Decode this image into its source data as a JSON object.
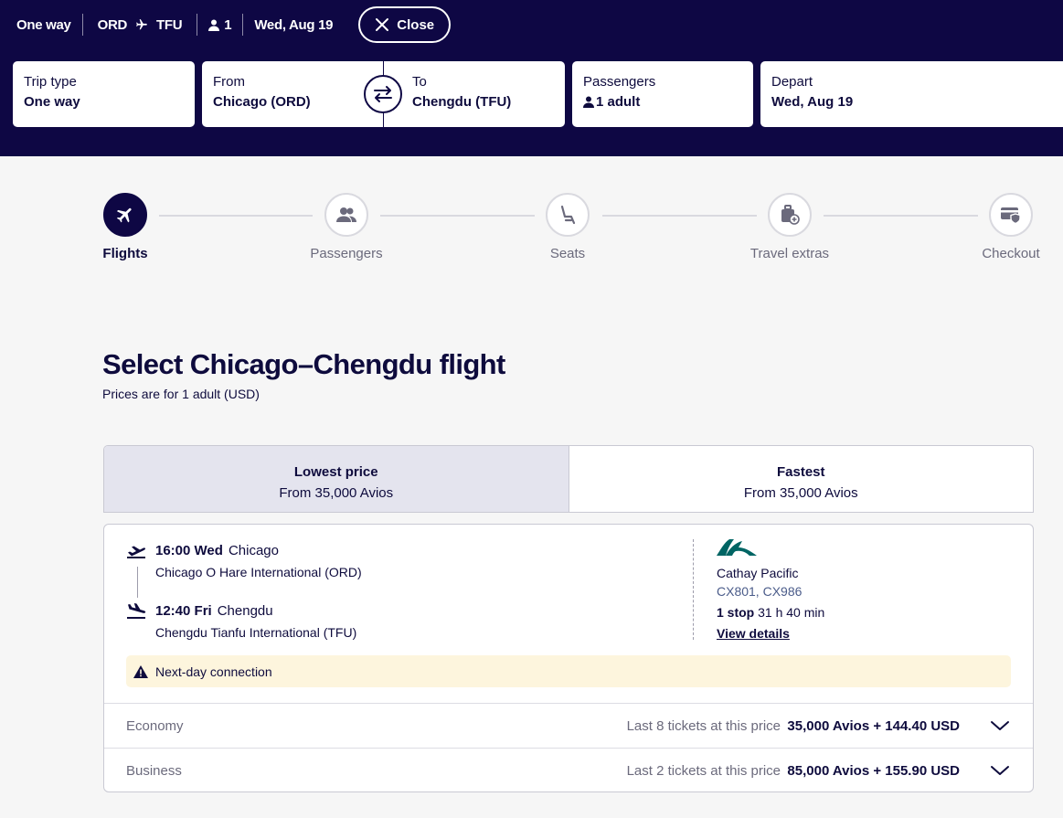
{
  "summary": {
    "trip_type": "One way",
    "origin": "ORD",
    "destination": "TFU",
    "passenger_count": "1",
    "date": "Wed, Aug 19",
    "close_label": "Close"
  },
  "search": {
    "trip_type": {
      "label": "Trip type",
      "value": "One way"
    },
    "from": {
      "label": "From",
      "value": "Chicago (ORD)"
    },
    "to": {
      "label": "To",
      "value": "Chengdu (TFU)"
    },
    "passengers": {
      "label": "Passengers",
      "value": "1 adult"
    },
    "depart": {
      "label": "Depart",
      "value": "Wed, Aug 19"
    }
  },
  "steps": [
    {
      "label": "Flights",
      "icon": "plane-icon",
      "active": true
    },
    {
      "label": "Passengers",
      "icon": "people-icon"
    },
    {
      "label": "Seats",
      "icon": "seat-icon"
    },
    {
      "label": "Travel extras",
      "icon": "luggage-icon"
    },
    {
      "label": "Checkout",
      "icon": "card-shield-icon"
    }
  ],
  "page": {
    "title": "Select Chicago–Chengdu flight",
    "subtitle": "Prices are for 1 adult (USD)"
  },
  "tabs": [
    {
      "name": "Lowest price",
      "price": "From 35,000 Avios",
      "selected": true
    },
    {
      "name": "Fastest",
      "price": "From 35,000 Avios"
    }
  ],
  "flight": {
    "departure": {
      "time": "16:00 Wed",
      "city": "Chicago",
      "airport": "Chicago O Hare International (ORD)"
    },
    "arrival": {
      "time": "12:40 Fri",
      "city": "Chengdu",
      "airport": "Chengdu Tianfu International (TFU)"
    },
    "airline": "Cathay Pacific",
    "flight_numbers": "CX801, CX986",
    "stops": "1 stop",
    "duration": "31 h 40 min",
    "details_link": "View details",
    "warning": "Next-day connection",
    "fares": [
      {
        "cabin": "Economy",
        "availability": "Last 8 tickets at this price",
        "price": "35,000 Avios + 144.40 USD"
      },
      {
        "cabin": "Business",
        "availability": "Last 2 tickets at this price",
        "price": "85,000 Avios + 155.90 USD"
      }
    ]
  },
  "colors": {
    "header_bg": "#0e0744",
    "text_primary": "#0e0b3d",
    "warning_bg": "#fdf5dd",
    "airline_logo": "#006564"
  }
}
